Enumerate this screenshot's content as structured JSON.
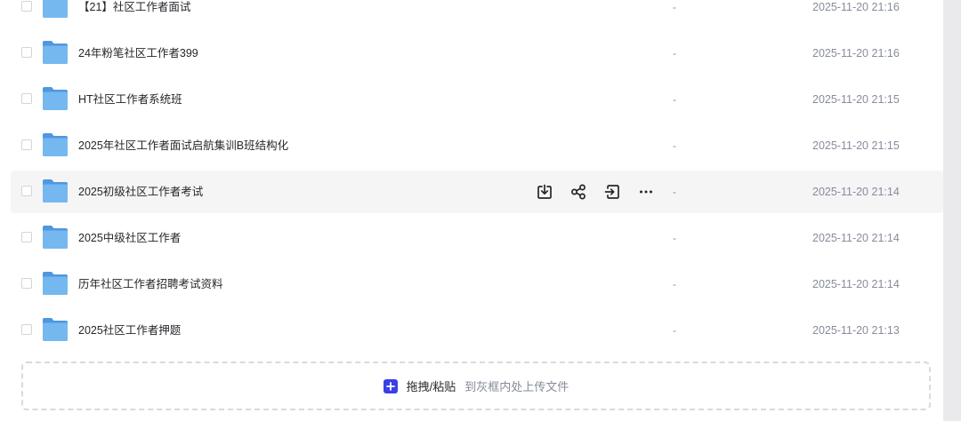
{
  "files": [
    {
      "name": "【21】社区工作者面试",
      "size": "-",
      "modified": "2025-11-20 21:16"
    },
    {
      "name": "24年粉笔社区工作者399",
      "size": "-",
      "modified": "2025-11-20 21:16"
    },
    {
      "name": "HT社区工作者系统班",
      "size": "-",
      "modified": "2025-11-20 21:15"
    },
    {
      "name": "2025年社区工作者面试启航集训B班结构化",
      "size": "-",
      "modified": "2025-11-20 21:15"
    },
    {
      "name": "2025初级社区工作者考试",
      "size": "-",
      "modified": "2025-11-20 21:14"
    },
    {
      "name": "2025中级社区工作者",
      "size": "-",
      "modified": "2025-11-20 21:14"
    },
    {
      "name": "历年社区工作者招聘考试资料",
      "size": "-",
      "modified": "2025-11-20 21:14"
    },
    {
      "name": "2025社区工作者押题",
      "size": "-",
      "modified": "2025-11-20 21:13"
    }
  ],
  "hover_actions": [
    "download-icon",
    "share-icon",
    "move-icon",
    "more-icon"
  ],
  "upload": {
    "main_label": "拖拽/粘贴",
    "hint": "到灰框内处上传文件"
  },
  "colors": {
    "accent": "#3b3fe6",
    "folder": "#6aaeea",
    "hover_row": "#f5f5f6"
  }
}
